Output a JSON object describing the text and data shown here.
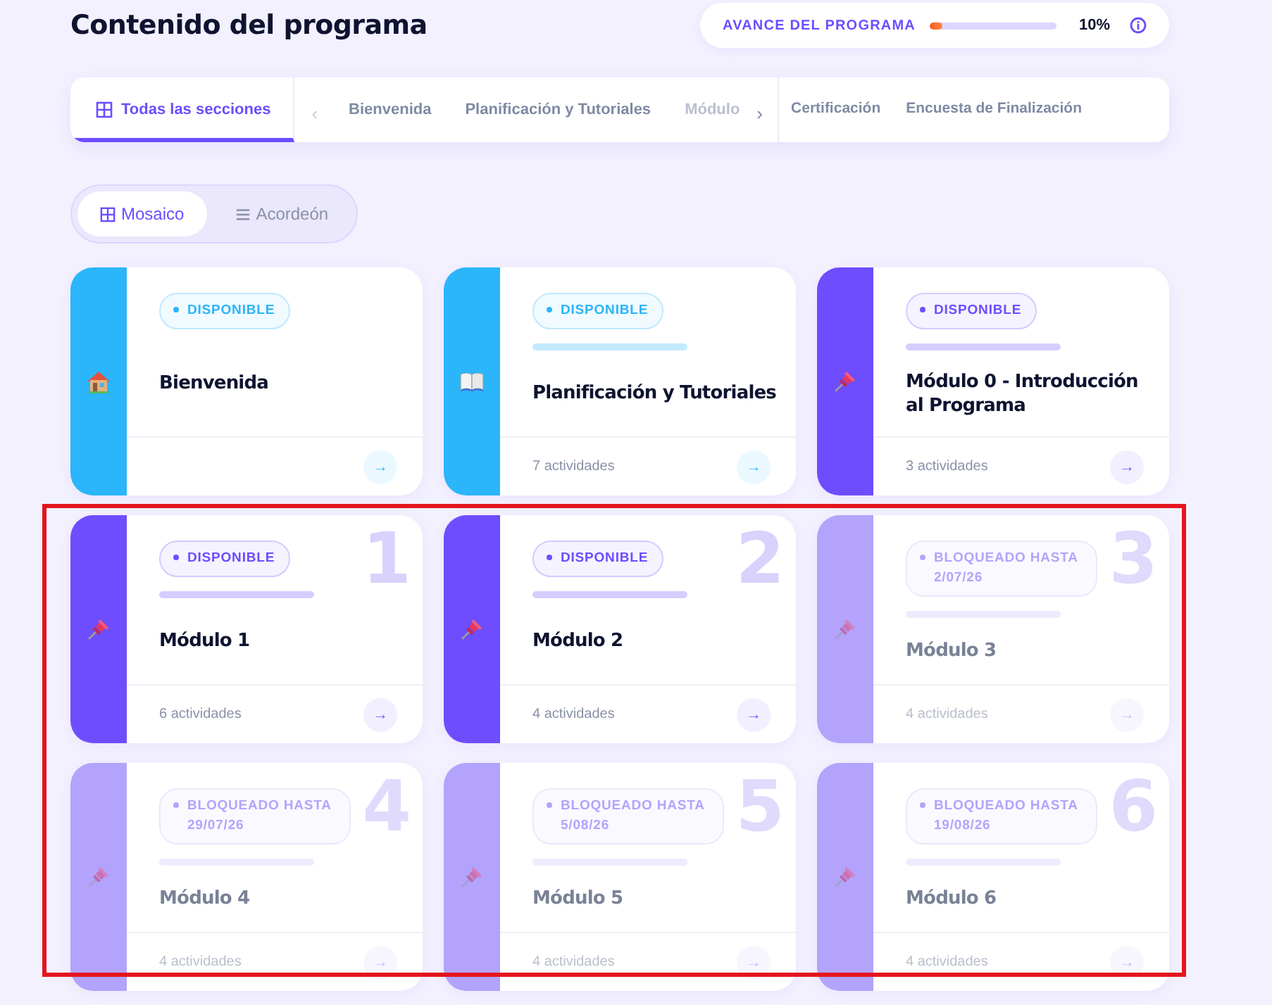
{
  "page_title": "Contenido del programa",
  "progress": {
    "label": "AVANCE DEL PROGRAMA",
    "level": 0.1,
    "reading": "10%"
  },
  "tabs": [
    {
      "kind": "main",
      "label": "Todas las secciones",
      "selected": true
    },
    {
      "kind": "prev",
      "label": "‹"
    },
    {
      "kind": "scroll",
      "label": "Bienvenida",
      "selected": false
    },
    {
      "kind": "scroll",
      "label": "Planificación y Tutoriales",
      "selected": false
    },
    {
      "kind": "cut",
      "label": "Módulo",
      "selected": false
    },
    {
      "kind": "next",
      "label": "›"
    },
    {
      "kind": "fixed",
      "label": "Certificación",
      "selected": false
    },
    {
      "kind": "fixed",
      "label": "Encuesta de Finalización",
      "selected": false
    }
  ],
  "view_toggle": [
    {
      "kind": "grid",
      "label": "Mosaico",
      "selected": true
    },
    {
      "kind": "list",
      "label": "Acordeón",
      "selected": false
    }
  ],
  "cards": [
    {
      "kind": "home",
      "color": "#2bb5fb",
      "locked": false,
      "badge": "DISPONIBLE",
      "accent_bar": false,
      "title": "Bienvenida",
      "arrow": "→"
    },
    {
      "kind": "book",
      "color": "#2bb5fb",
      "locked": false,
      "badge": "DISPONIBLE",
      "accent_bar": true,
      "title": "Planificación y Tutoriales",
      "activities": "7 actividades",
      "arrow": "→"
    },
    {
      "kind": "module",
      "color": "#6e4dff",
      "locked": false,
      "badge": "DISPONIBLE",
      "accent_bar": true,
      "title": "Módulo 0 - Introducción al Programa",
      "activities": "3 actividades",
      "arrow": "→"
    },
    {
      "kind": "module",
      "color": "#6e4dff",
      "locked": false,
      "badge": "DISPONIBLE",
      "accent_bar": true,
      "title": "Módulo 1",
      "activities": "6 actividades",
      "number": "1",
      "arrow": "→"
    },
    {
      "kind": "module",
      "color": "#6e4dff",
      "locked": false,
      "badge": "DISPONIBLE",
      "accent_bar": true,
      "title": "Módulo 2",
      "activities": "4 actividades",
      "number": "2",
      "arrow": "→"
    },
    {
      "kind": "module",
      "color": "#b3a3fc",
      "locked": true,
      "badge": "BLOQUEADO HASTA 2/07/26",
      "accent_bar": true,
      "title": "Módulo 3",
      "activities": "4 actividades",
      "number": "3",
      "arrow": "→"
    },
    {
      "kind": "module",
      "color": "#b3a3fc",
      "locked": true,
      "badge": "BLOQUEADO HASTA 29/07/26",
      "accent_bar": true,
      "title": "Módulo 4",
      "activities": "4 actividades",
      "number": "4",
      "arrow": "→"
    },
    {
      "kind": "module",
      "color": "#b3a3fc",
      "locked": true,
      "badge": "BLOQUEADO HASTA 5/08/26",
      "accent_bar": true,
      "title": "Módulo 5",
      "activities": "4 actividades",
      "number": "5",
      "arrow": "→"
    },
    {
      "kind": "module",
      "color": "#b3a3fc",
      "locked": true,
      "badge": "BLOQUEADO HASTA 19/08/26",
      "accent_bar": true,
      "title": "Módulo 6",
      "activities": "4 actividades",
      "number": "6",
      "arrow": "→"
    }
  ],
  "highlight": {
    "shown": true
  }
}
